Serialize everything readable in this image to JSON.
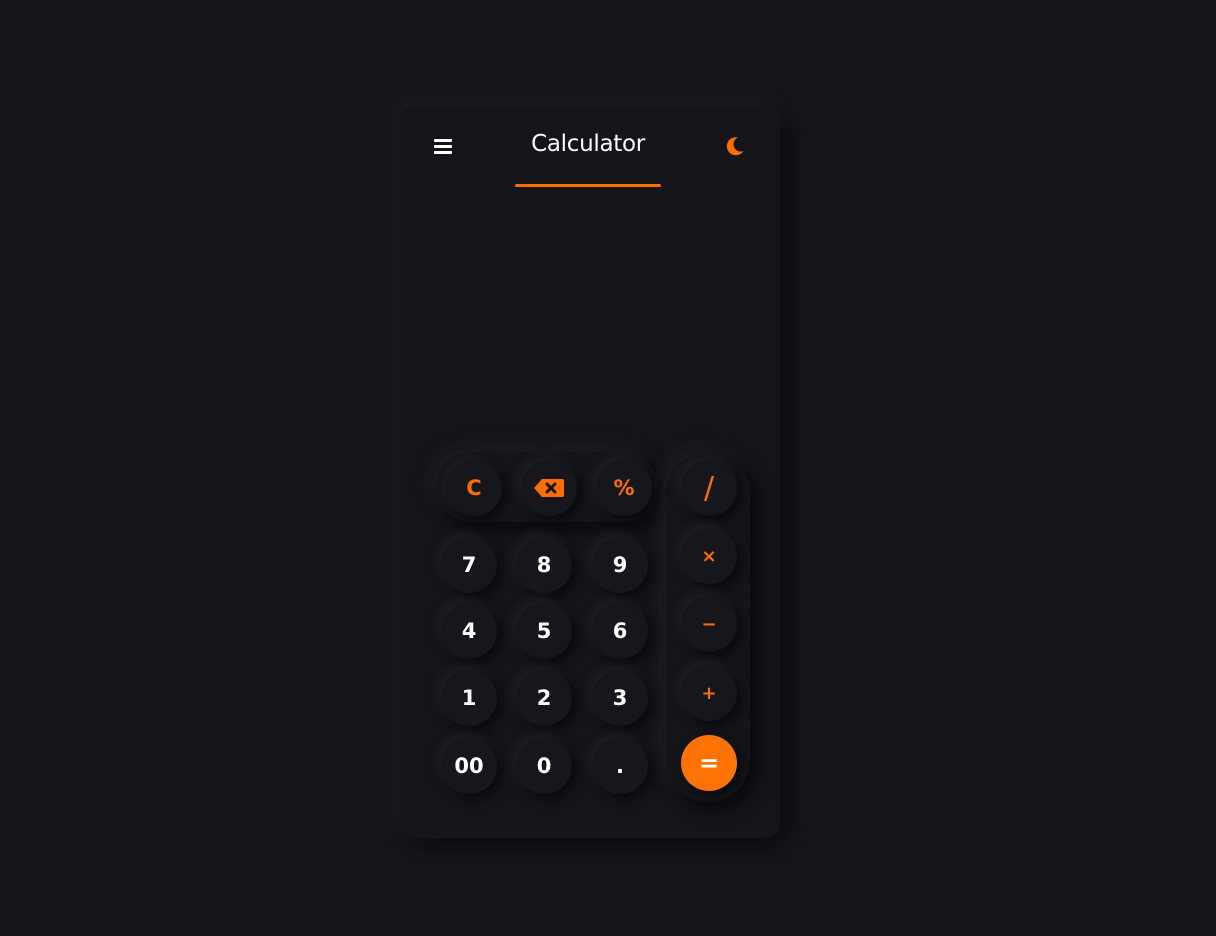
{
  "header": {
    "title": "Calculator",
    "accent_color": "#ff6d00",
    "menu_icon": "hamburger-menu-icon",
    "theme_icon": "moon-icon"
  },
  "display": {
    "expression": "",
    "result": ""
  },
  "keys": {
    "clear": "C",
    "backspace_icon": "backspace-icon",
    "percent": "%",
    "divide": "/",
    "multiply": "×",
    "subtract": "−",
    "add": "+",
    "equals": "=",
    "seven": "7",
    "eight": "8",
    "nine": "9",
    "four": "4",
    "five": "5",
    "six": "6",
    "one": "1",
    "two": "2",
    "three": "3",
    "double_zero": "00",
    "zero": "0",
    "decimal": "."
  },
  "colors": {
    "background": "#15161b",
    "surface": "#141519",
    "accent": "#ff6d00",
    "digit_text": "#ffffff"
  }
}
